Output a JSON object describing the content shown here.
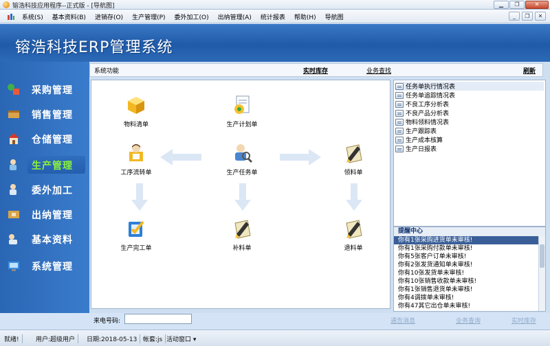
{
  "window": {
    "title": "镕浩科技应用程序--正式版 - [导航图]"
  },
  "menu": {
    "items": [
      "系统(S)",
      "基本资料(B)",
      "进销存(O)",
      "生产管理(P)",
      "委外加工(O)",
      "出纳管理(A)",
      "统计报表",
      "帮助(H)",
      "导航图"
    ]
  },
  "banner": {
    "title": "镕浩科技ERP管理系统"
  },
  "sidebar": {
    "items": [
      "采购管理",
      "销售管理",
      "仓储管理",
      "生产管理",
      "委外加工",
      "出纳管理",
      "基本资料",
      "系统管理"
    ],
    "active_index": 3
  },
  "toolbar": {
    "label": "系统功能",
    "realtime_stock": "实时库存",
    "business_query": "业务查找",
    "refresh": "刷新"
  },
  "flow": {
    "bom": "物料清单",
    "production_plan": "生产计划单",
    "process_transfer": "工序流转单",
    "production_task": "生产任务单",
    "material_pick": "领料单",
    "production_complete": "生产完工单",
    "supplement": "补料单",
    "return": "退料单"
  },
  "reports": [
    "任务单执行情况表",
    "任务单追踪情况表",
    "不良工序分析表",
    "不良产品分析表",
    "物料领料情况表",
    "生产跟踪表",
    "生产成本核算",
    "生产日报表"
  ],
  "remind": {
    "title": "提醒中心",
    "lines": [
      "你有1张采购进货单未审核!",
      "你有1张采购付款单未审核!",
      "你有5张客户订单未审核!",
      "你有2张发货通知单未审核!",
      "你有10张发货单未审核!",
      "你有10张销售收款单未审核!",
      "你有1张销售退货单未审核!",
      "你有4调拨单未审核!",
      "你有47其它出仓单未审核!"
    ]
  },
  "footer": {
    "phone_label": "来电号码:",
    "phone_value": "",
    "link_notice": "通告消息",
    "link_query": "业务查询",
    "link_stock": "实时库存"
  },
  "status": {
    "ready": "就绪!",
    "user": "用户:超级用户",
    "date": "日期:2018-05-13",
    "account": "帐套:js",
    "active_window": "活动窗口 ▾"
  }
}
